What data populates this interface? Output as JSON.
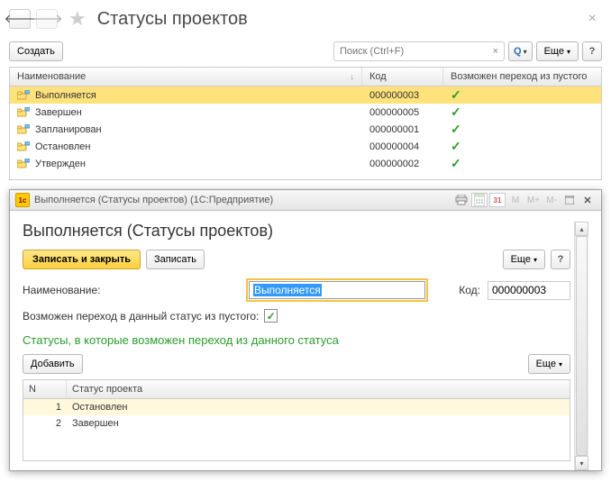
{
  "header": {
    "title": "Статусы проектов"
  },
  "toolbar": {
    "create": "Создать",
    "search_placeholder": "Поиск (Ctrl+F)",
    "more": "Еще",
    "search_dropdown": "▾"
  },
  "table": {
    "col_name": "Наименование",
    "col_code": "Код",
    "col_allowed": "Возможен переход из пустого",
    "rows": [
      {
        "name": "Выполняется",
        "code": "000000003",
        "allowed": true,
        "selected": true
      },
      {
        "name": "Завершен",
        "code": "000000005",
        "allowed": true,
        "selected": false
      },
      {
        "name": "Запланирован",
        "code": "000000001",
        "allowed": true,
        "selected": false
      },
      {
        "name": "Остановлен",
        "code": "000000004",
        "allowed": true,
        "selected": false
      },
      {
        "name": "Утвержден",
        "code": "000000002",
        "allowed": true,
        "selected": false
      }
    ]
  },
  "child": {
    "titlebar": "Выполняется (Статусы проектов)  (1С:Предприятие)",
    "title": "Выполняется (Статусы проектов)",
    "save_close": "Записать и закрыть",
    "save": "Записать",
    "more": "Еще",
    "name_label": "Наименование:",
    "name_value": "Выполняется",
    "code_label": "Код:",
    "code_value": "000000003",
    "checkbox_label": "Возможен переход в данный статус из пустого:",
    "checkbox_checked": true,
    "section_title": "Статусы, в которые возможен переход из данного статуса",
    "add": "Добавить",
    "sub_col_n": "N",
    "sub_col_status": "Статус проекта",
    "sub_rows": [
      {
        "n": "1",
        "status": "Остановлен",
        "hl": true
      },
      {
        "n": "2",
        "status": "Завершен",
        "hl": false
      }
    ],
    "cal_day": "31"
  }
}
